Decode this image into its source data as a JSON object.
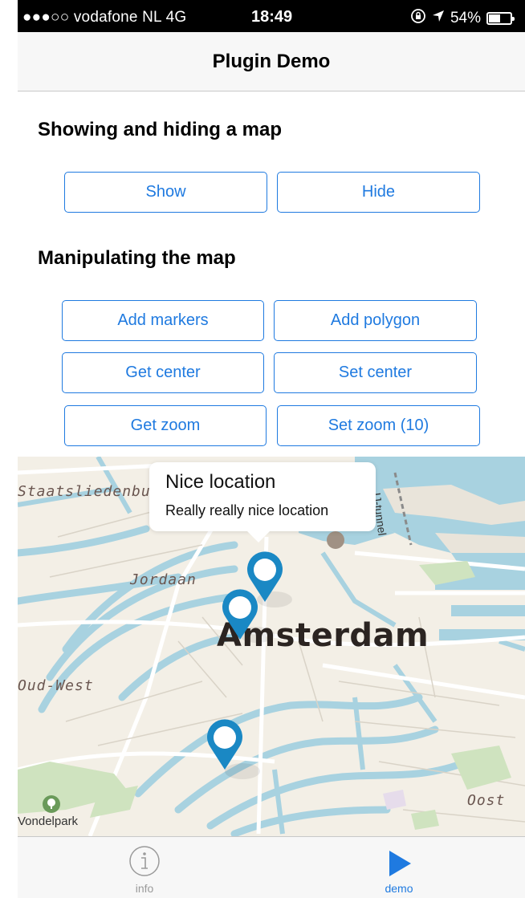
{
  "status_bar": {
    "carrier": "●●●○○ vodafone NL  4G",
    "time": "18:49",
    "battery": "54%",
    "battery_level": 0.54
  },
  "nav": {
    "title": "Plugin Demo"
  },
  "sections": {
    "show_hide": {
      "title": "Showing and hiding a map",
      "buttons": {
        "show": "Show",
        "hide": "Hide"
      }
    },
    "manipulate": {
      "title": "Manipulating the map",
      "buttons": {
        "add_markers": "Add markers",
        "add_polygon": "Add polygon",
        "get_center": "Get center",
        "set_center": "Set center",
        "get_zoom": "Get zoom",
        "set_zoom": "Set zoom (10)"
      }
    }
  },
  "map": {
    "callout": {
      "title": "Nice location",
      "subtitle": "Really really nice location"
    },
    "labels": {
      "staatsliedenbuurt": "Staatsliedenbu",
      "jordaan": "Jordaan",
      "amsterdam": "Amsterdam",
      "oud_west": "Oud-West",
      "oost": "Oost",
      "vondelpark": "Vondelpark",
      "ij_tunnel": "IJ-tunnel"
    },
    "colors": {
      "water": "#a8d2e0",
      "land": "#f3efe6",
      "park": "#cfe3bf",
      "pin": "#1a88c4"
    }
  },
  "tabs": {
    "info": {
      "label": "info",
      "icon": "info-circle-icon"
    },
    "demo": {
      "label": "demo",
      "icon": "play-icon"
    },
    "active_color": "#1f7ae0",
    "inactive_color": "#9a9a9a"
  }
}
